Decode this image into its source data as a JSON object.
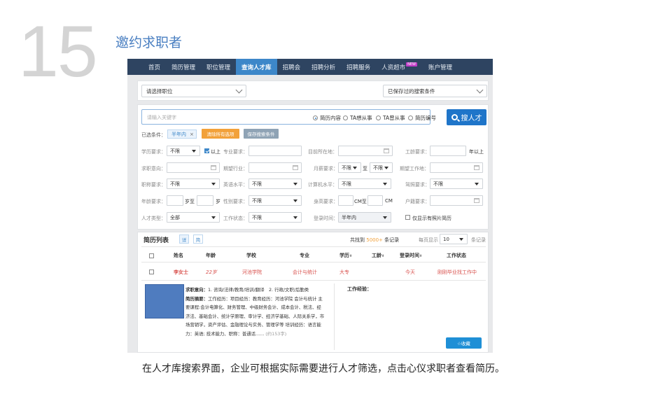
{
  "slide": {
    "number": "15",
    "title": "邀约求职者",
    "caption": "在人才库搜索界面，企业可根据实际需要进行人才筛选，点击心仪求职者查看简历。"
  },
  "nav": {
    "items": [
      "首页",
      "简历管理",
      "职位管理",
      "查询人才库",
      "招聘会",
      "招聘分析",
      "招聘服务",
      "人资超市",
      "账户管理"
    ],
    "active_index": 3,
    "new_badge": "NEW"
  },
  "top_filters": {
    "position_select": "请选择职位",
    "saved_conditions_select": "已保存过的搜索条件"
  },
  "search": {
    "placeholder": "请输入关键字",
    "scopes": [
      "简历内容",
      "TA想从事",
      "TA曾从事",
      "简历编号"
    ],
    "selected_scope": "简历内容",
    "button_label": "搜人才",
    "selected_conditions_label": "已选条件：",
    "chip_label": "半年内",
    "chip_remove": "×",
    "clear_button": "清除所有选项",
    "save_button": "保存搜索条件"
  },
  "filters": {
    "education_label": "学历要求：",
    "education_value": "不限",
    "above_label": "以上",
    "major_label": "专业要求：",
    "location_label": "目前所在地：",
    "experience_label": "工龄要求：",
    "experience_suffix": "年以上",
    "intent_label": "求职意向：",
    "industry_label": "期望行业：",
    "salary_label": "月薪要求：",
    "salary_from": "不限",
    "salary_to_label": "至",
    "salary_to": "不限",
    "work_place_label": "期望工作地：",
    "title_label": "职称要求：",
    "title_value": "不限",
    "english_label": "英语水平：",
    "english_value": "不限",
    "computer_label": "计算机水平：",
    "computer_value": "不限",
    "driving_label": "驾照要求：",
    "driving_value": "不限",
    "age_label": "年龄要求：",
    "age_mid": "岁至",
    "age_suffix": "岁",
    "gender_label": "性别要求：",
    "gender_value": "不限",
    "height_label": "身高要求：",
    "height_mid": "CM至",
    "height_suffix": "CM",
    "hukou_label": "户籍要求：",
    "talent_type_label": "人才类型：",
    "talent_type_value": "全部",
    "work_status_label": "工作状态：",
    "work_status_value": "不限",
    "login_time_label": "登录时间：",
    "login_time_value": "半年内",
    "photo_only_label": "仅显示有照片简历"
  },
  "results": {
    "title": "简历列表",
    "view_detail": "详",
    "view_brief": "简",
    "found_prefix": "共找到",
    "found_count": "5000+",
    "found_suffix": "条记录",
    "per_page_label": "每页显示",
    "per_page_value": "10",
    "per_page_suffix": "条记录",
    "columns": [
      "姓名",
      "年龄",
      "学校",
      "专业",
      "学历",
      "工龄",
      "登录时间",
      "工作状态"
    ],
    "row": {
      "name": "李女士",
      "age": "22岁",
      "school": "河池学院",
      "major": "会计与统计",
      "education": "大专",
      "seniority": "",
      "login_time": "今天",
      "work_status": "刚刚毕业找工作中"
    },
    "detail": {
      "intent_label": "求职意向：",
      "intent_text": "1. 咨询/法律/教育/培训/翻译　2. 行政/文职/后勤类",
      "summary_label": "简历摘要：",
      "summary_text": "工作经历：项目经历：教育经历：河池学院 会计与统计 主要课程:会计电算化、财务管理、中级财务会计、成本会计、税法、经济法、基础会计、统计学原理、审计学、经济学基础、人际关系学，市场营销学，资产评估、金融理论与实务、管理学等 培训经历：语言能力：英语; 技术能力、职称：普通话......",
      "char_count": "(约153字)",
      "experience_label": "工作经验：",
      "favorite_button": "☆收藏"
    }
  },
  "colors": {
    "nav_bg": "#2e4461",
    "nav_active": "#3d87c9",
    "primary": "#1f75c9",
    "warning": "#f2a13a",
    "highlight": "#d9534f",
    "title_blue": "#4a7fc1"
  }
}
